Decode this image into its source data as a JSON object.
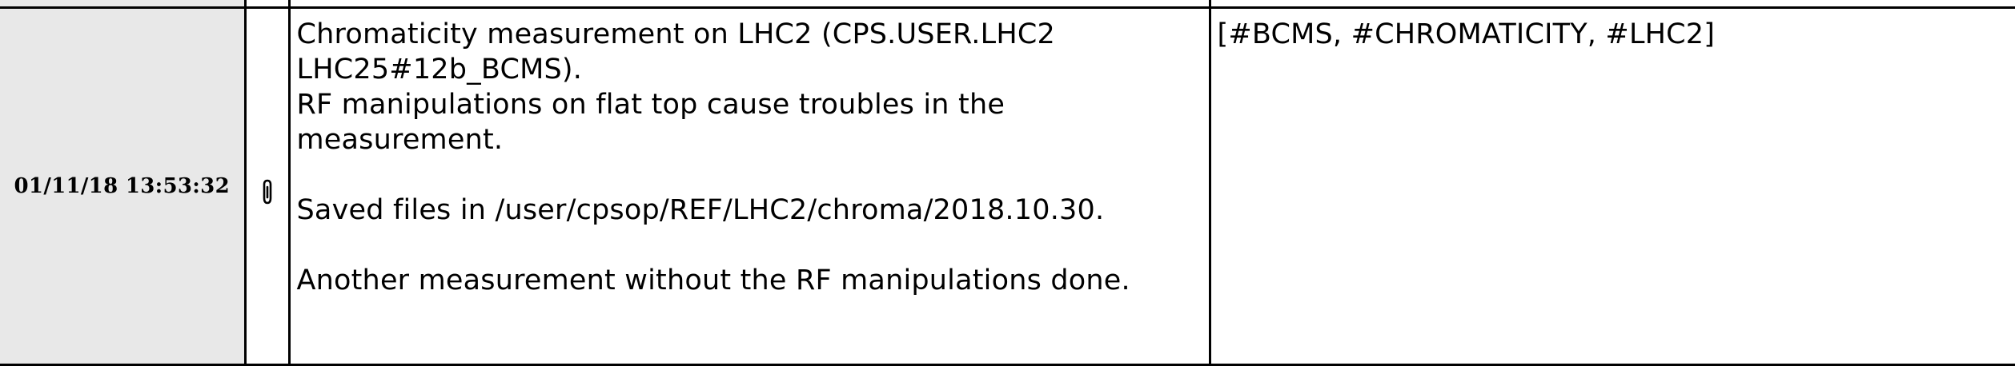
{
  "entry": {
    "timestamp": "01/11/18 13:53:32",
    "attachment_icon": "paperclip-icon",
    "comment": {
      "line1": "Chromaticity measurement on LHC2 (CPS.USER.LHC2",
      "line2": "LHC25#12b_BCMS).",
      "line3": "RF manipulations on flat top cause troubles in the",
      "line4": "measurement.",
      "line5": "Saved files in /user/cpsop/REF/LHC2/chroma/2018.10.30.",
      "line6": "Another measurement without the RF manipulations done."
    },
    "tags": "[#BCMS, #CHROMATICITY, #LHC2]"
  },
  "colors": {
    "date_cell_background": "#e8e8e8",
    "border": "#000000",
    "text": "#000000"
  }
}
